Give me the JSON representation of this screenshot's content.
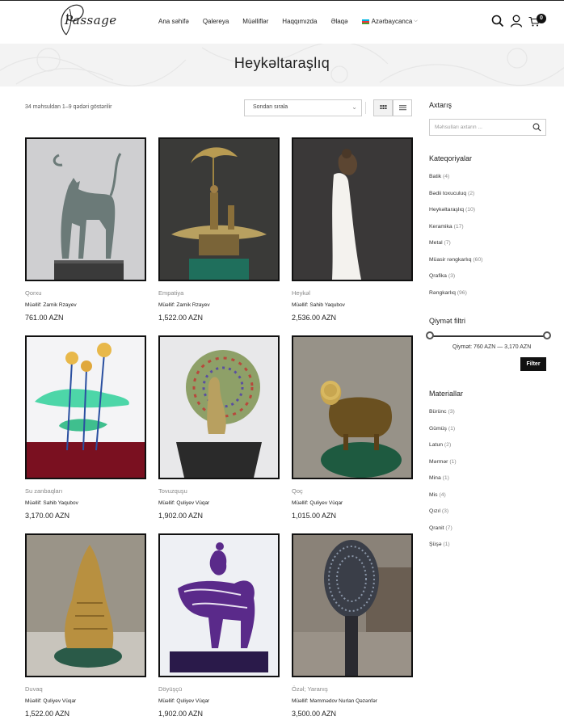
{
  "header": {
    "logo_text": "Passage",
    "nav": [
      "Ana səhifə",
      "Qalereya",
      "Müəlliflər",
      "Haqqımızda",
      "Əlaqə"
    ],
    "language": "Azərbaycanca",
    "cart_count": "0",
    "icons": [
      "search-icon",
      "user-icon",
      "cart-icon"
    ]
  },
  "page": {
    "title": "Heykəltaraşlıq"
  },
  "toolbar": {
    "result_count": "34 məhsuldan 1–9 qədəri göstərilir",
    "sort_value": "Sondan sırala",
    "view_modes": [
      "grid-view-icon",
      "list-view-icon"
    ]
  },
  "products": [
    {
      "category": "Qorxu",
      "author": "Müəllif: Zamik Rzayev",
      "price": "761.00 AZN"
    },
    {
      "category": "Empatiya",
      "author": "Müəllif: Zamik Rzayev",
      "price": "1,522.00 AZN"
    },
    {
      "category": "Heykəl",
      "author": "Müəllif: Sahib Yaqubov",
      "price": "2,536.00 AZN"
    },
    {
      "category": "Su zanbaqları",
      "author": "Müəllif: Sahib Yaqubov",
      "price": "3,170.00 AZN"
    },
    {
      "category": "Tovuzquşu",
      "author": "Müəllif: Quliyev Vüqar",
      "price": "1,902.00 AZN"
    },
    {
      "category": "Qoç",
      "author": "Müəllif: Quliyev Vüqar",
      "price": "1,015.00 AZN"
    },
    {
      "category": "Duvaq",
      "author": "Müəllif: Quliyev Vüqar",
      "price": "1,522.00 AZN"
    },
    {
      "category": "Döyüşçü",
      "author": "Müəllif: Quliyev Vüqar",
      "price": "1,902.00 AZN"
    },
    {
      "category": "Özəl; Yaranış",
      "author": "Müəllif: Məmmədov Nurlan Qəzənfər",
      "price": "3,500.00 AZN"
    }
  ],
  "sidebar": {
    "search_title": "Axtarış",
    "search_placeholder": "Məhsulları axtarın ...",
    "categories_title": "Kateqoriyalar",
    "categories": [
      {
        "name": "Batik",
        "count": "(4)"
      },
      {
        "name": "Bədii toxuculuq",
        "count": "(2)"
      },
      {
        "name": "Heykəltaraşlıq",
        "count": "(10)"
      },
      {
        "name": "Keramika",
        "count": "(17)"
      },
      {
        "name": "Metal",
        "count": "(7)"
      },
      {
        "name": "Müasir rəngkarlıq",
        "count": "(60)"
      },
      {
        "name": "Qrafika",
        "count": "(3)"
      },
      {
        "name": "Rəngkarlıq",
        "count": "(96)"
      }
    ],
    "price_title": "Qiymət filtri",
    "price_label": "Qiymət: 760 AZN — 3,170 AZN",
    "price_range": {
      "min": 760,
      "max": 3170
    },
    "filter_button": "Filter",
    "materials_title": "Materiallar",
    "materials": [
      {
        "name": "Bürünc",
        "count": "(3)"
      },
      {
        "name": "Gümüş",
        "count": "(1)"
      },
      {
        "name": "Latun",
        "count": "(2)"
      },
      {
        "name": "Mərmər",
        "count": "(1)"
      },
      {
        "name": "Mina",
        "count": "(1)"
      },
      {
        "name": "Mis",
        "count": "(4)"
      },
      {
        "name": "Qızıl",
        "count": "(3)"
      },
      {
        "name": "Qranit",
        "count": "(7)"
      },
      {
        "name": "Şüşə",
        "count": "(1)"
      }
    ]
  }
}
